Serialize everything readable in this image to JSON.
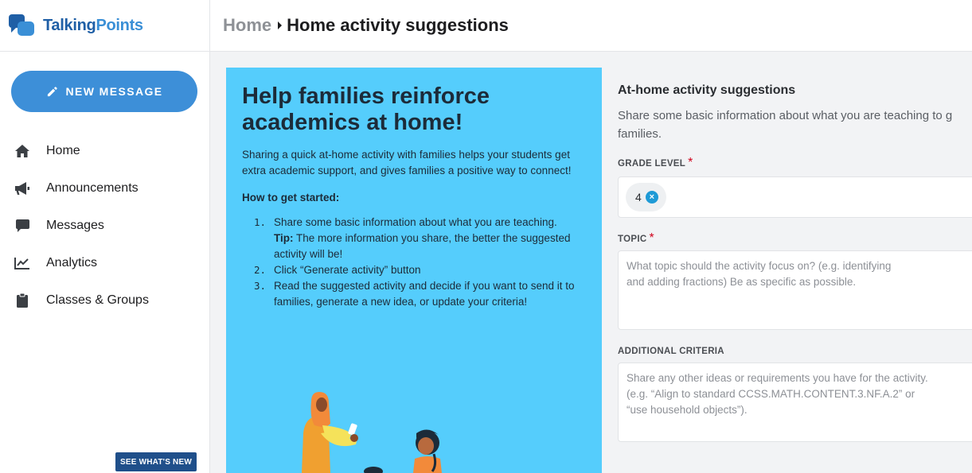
{
  "app": {
    "logo_primary": "Talking",
    "logo_secondary": "Points",
    "brand_color": "#1f5fa6",
    "accent_color": "#3d8fd8"
  },
  "sidebar": {
    "new_message_label": "NEW MESSAGE",
    "items": [
      {
        "label": "Home",
        "icon": "home-icon"
      },
      {
        "label": "Announcements",
        "icon": "megaphone-icon"
      },
      {
        "label": "Messages",
        "icon": "chat-bubble-icon"
      },
      {
        "label": "Analytics",
        "icon": "line-chart-icon"
      },
      {
        "label": "Classes & Groups",
        "icon": "clipboard-icon"
      }
    ],
    "whats_new_label": "SEE WHAT'S NEW"
  },
  "breadcrumb": {
    "root": "Home",
    "current": "Home activity suggestions"
  },
  "hero": {
    "background": "#55cdfc",
    "title": "Help families reinforce academics at home!",
    "intro": "Sharing a quick at-home activity with families helps your students get extra academic support, and gives families a positive way to connect!",
    "how_to": "How to get started:",
    "steps": [
      {
        "num": "1.",
        "text": "Share some basic information about what you are teaching.",
        "tip_label": "Tip:",
        "tip_text": " The more information you share, the better the suggested activity will be!"
      },
      {
        "num": "2.",
        "text": "Click “Generate activity” button"
      },
      {
        "num": "3.",
        "text": "Read the suggested activity and decide if you want to send it to families, generate a new idea, or update your criteria!"
      }
    ]
  },
  "form": {
    "title": "At-home activity suggestions",
    "description_line1": "Share some basic information about what you are teaching to g",
    "description_line2": "families.",
    "grade_label": "GRADE LEVEL",
    "grade_value": "4",
    "topic_label": "TOPIC",
    "topic_placeholder_1": "What topic should the activity focus on? (e.g. identifying",
    "topic_placeholder_2": "and adding fractions) Be as specific as possible.",
    "criteria_label": "ADDITIONAL CRITERIA",
    "criteria_placeholder_1": "Share any other ideas or requirements you have for the activity.",
    "criteria_placeholder_2": "(e.g. “Align to standard CCSS.MATH.CONTENT.3.NF.A.2” or",
    "criteria_placeholder_3": "“use household objects”).",
    "required_mark": "*"
  }
}
